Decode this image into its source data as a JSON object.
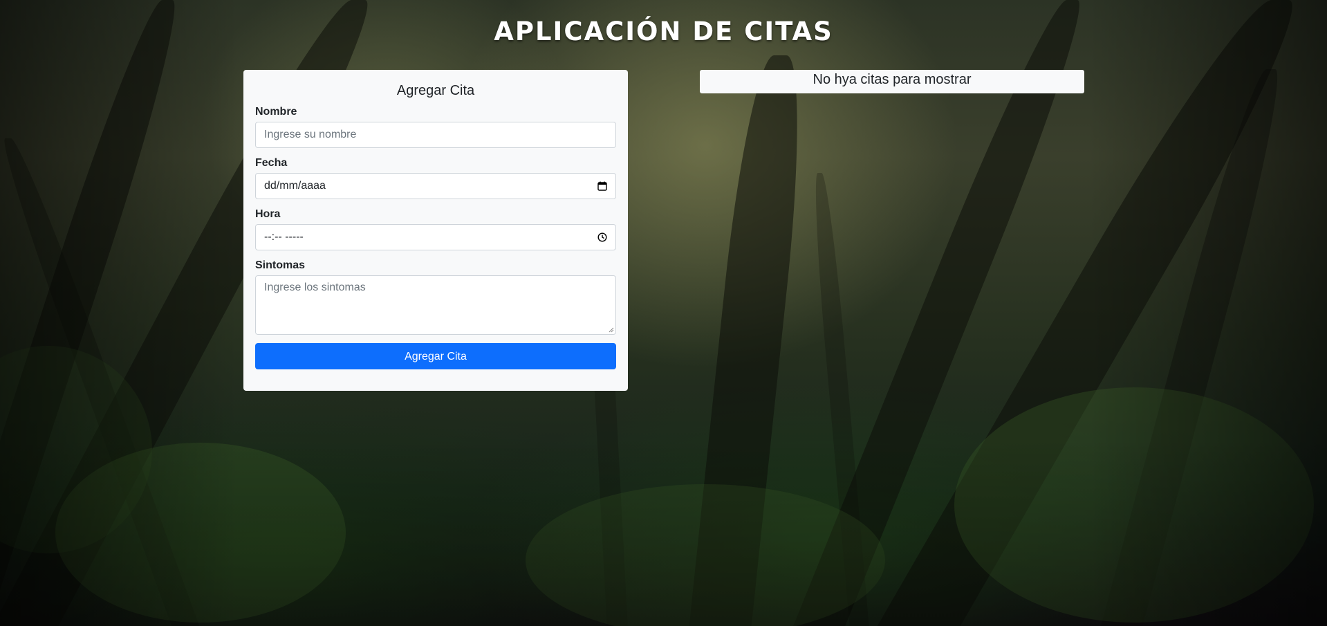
{
  "header": {
    "title": "APLICACIÓN DE CITAS"
  },
  "form": {
    "title": "Agregar Cita",
    "fields": {
      "nombre": {
        "label": "Nombre",
        "placeholder": "Ingrese su nombre"
      },
      "fecha": {
        "label": "Fecha",
        "value": "dd/mm/aaaa",
        "icon": "calendar-icon"
      },
      "hora": {
        "label": "Hora",
        "value": "--:-- -----",
        "icon": "clock-icon"
      },
      "sintomas": {
        "label": "Sintomas",
        "placeholder": "Ingrese los sintomas"
      }
    },
    "submit_label": "Agregar Cita"
  },
  "list": {
    "empty_message": "No hya citas para mostrar"
  },
  "colors": {
    "primary": "#0d6efd",
    "card_bg": "#f8f9fa",
    "title_text": "#ffffff"
  }
}
